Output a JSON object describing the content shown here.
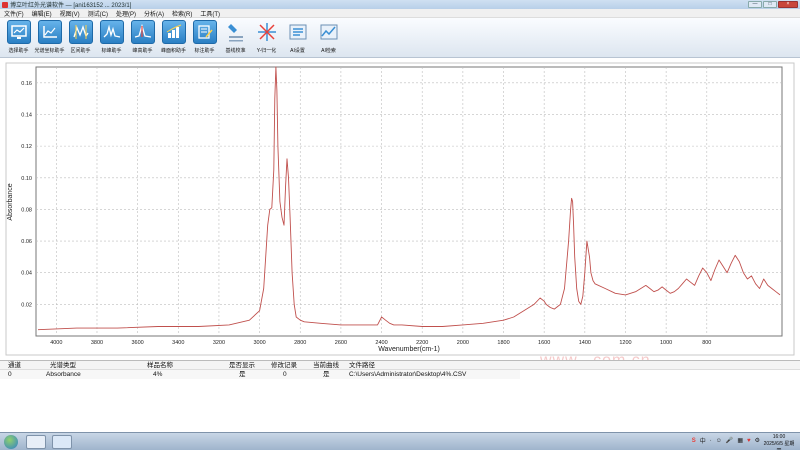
{
  "window": {
    "title": "博立叶红外光谱软件 — [ani163152 ... 2023/1]"
  },
  "menubar": {
    "items": [
      "文件(F)",
      "编辑(E)",
      "视图(V)",
      "测试(C)",
      "处理(P)",
      "分析(A)",
      "检索(R)",
      "工具(T)"
    ]
  },
  "toolbar": {
    "items": [
      {
        "label": "选择助手",
        "icon": "screen-icon"
      },
      {
        "label": "光谱坐标助手",
        "icon": "axes-icon"
      },
      {
        "label": "区间助手",
        "icon": "range-icon"
      },
      {
        "label": "标峰助手",
        "icon": "peak-icon"
      },
      {
        "label": "峰高助手",
        "icon": "peak-height-icon"
      },
      {
        "label": "峰面积助手",
        "icon": "peak-area-icon"
      },
      {
        "label": "标注助手",
        "icon": "annotate-icon"
      },
      {
        "label": "基线校准",
        "icon": "baseline-icon"
      },
      {
        "label": "Y-归一化",
        "icon": "normalize-icon"
      },
      {
        "label": "AI设置",
        "icon": "ai-settings-icon"
      },
      {
        "label": "AI检索",
        "icon": "ai-search-icon"
      }
    ]
  },
  "chart_data": {
    "type": "line",
    "xlabel": "Wavenumber(cm-1)",
    "ylabel": "Absorbance",
    "xlim": [
      4100,
      430
    ],
    "ylim": [
      0.0,
      0.17
    ],
    "x_ticks": [
      "4000",
      "3800",
      "3600",
      "3400",
      "3200",
      "3000",
      "2800",
      "2600",
      "2400",
      "2200",
      "2000",
      "1800",
      "1600",
      "1400",
      "1200",
      "1000",
      "800"
    ],
    "y_ticks": [
      "0.02",
      "0.04",
      "0.06",
      "0.08",
      "0.10",
      "0.12",
      "0.14",
      "0.16"
    ],
    "grid": true,
    "series": [
      {
        "color": "#c0504d",
        "x": [
          4090,
          3900,
          3700,
          3500,
          3300,
          3150,
          3050,
          3000,
          2980,
          2960,
          2950,
          2940,
          2930,
          2925,
          2920,
          2915,
          2910,
          2900,
          2890,
          2880,
          2872,
          2865,
          2858,
          2850,
          2840,
          2830,
          2820,
          2800,
          2780,
          2700,
          2600,
          2500,
          2420,
          2400,
          2380,
          2360,
          2340,
          2300,
          2200,
          2100,
          2000,
          1900,
          1800,
          1750,
          1700,
          1650,
          1620,
          1600,
          1590,
          1570,
          1550,
          1520,
          1500,
          1480,
          1470,
          1465,
          1460,
          1455,
          1450,
          1440,
          1430,
          1420,
          1410,
          1400,
          1390,
          1377,
          1370,
          1360,
          1350,
          1300,
          1250,
          1200,
          1150,
          1100,
          1080,
          1060,
          1040,
          1020,
          1000,
          980,
          960,
          940,
          920,
          900,
          880,
          860,
          840,
          820,
          800,
          780,
          760,
          740,
          720,
          700,
          680,
          660,
          640,
          620,
          600,
          580,
          560,
          540,
          520,
          500,
          480,
          460,
          440
        ],
        "y": [
          0.004,
          0.005,
          0.005,
          0.006,
          0.006,
          0.007,
          0.01,
          0.016,
          0.03,
          0.07,
          0.08,
          0.081,
          0.105,
          0.15,
          0.17,
          0.155,
          0.12,
          0.085,
          0.075,
          0.07,
          0.095,
          0.112,
          0.1,
          0.075,
          0.04,
          0.02,
          0.012,
          0.01,
          0.009,
          0.008,
          0.007,
          0.007,
          0.007,
          0.012,
          0.01,
          0.008,
          0.007,
          0.007,
          0.006,
          0.006,
          0.007,
          0.008,
          0.01,
          0.012,
          0.016,
          0.02,
          0.024,
          0.022,
          0.02,
          0.018,
          0.017,
          0.02,
          0.03,
          0.06,
          0.08,
          0.087,
          0.085,
          0.07,
          0.05,
          0.03,
          0.022,
          0.02,
          0.025,
          0.04,
          0.06,
          0.05,
          0.04,
          0.035,
          0.033,
          0.03,
          0.027,
          0.026,
          0.028,
          0.032,
          0.03,
          0.028,
          0.029,
          0.031,
          0.029,
          0.027,
          0.028,
          0.03,
          0.033,
          0.036,
          0.034,
          0.032,
          0.038,
          0.043,
          0.04,
          0.035,
          0.042,
          0.048,
          0.044,
          0.04,
          0.046,
          0.051,
          0.047,
          0.04,
          0.036,
          0.038,
          0.033,
          0.03,
          0.036,
          0.032,
          0.03,
          0.028,
          0.026
        ]
      }
    ]
  },
  "table": {
    "headers": [
      "通道",
      "光谱类型",
      "样品名称",
      "是否显示",
      "修改记录",
      "当前曲线",
      "文件路径"
    ],
    "rows": [
      [
        "0",
        "Absorbance",
        "4%",
        "是",
        "0",
        "是",
        "C:\\Users\\Administrator\\Desktop\\4%.CSV"
      ]
    ]
  },
  "watermark": "www.            .com.cn",
  "taskbar": {
    "tray": [
      "S",
      "中",
      "·",
      "☺",
      "🎤",
      "▦",
      "♥",
      "⚙"
    ],
    "clock_time": "16:00",
    "clock_date": "2025/6/5 星期四"
  }
}
